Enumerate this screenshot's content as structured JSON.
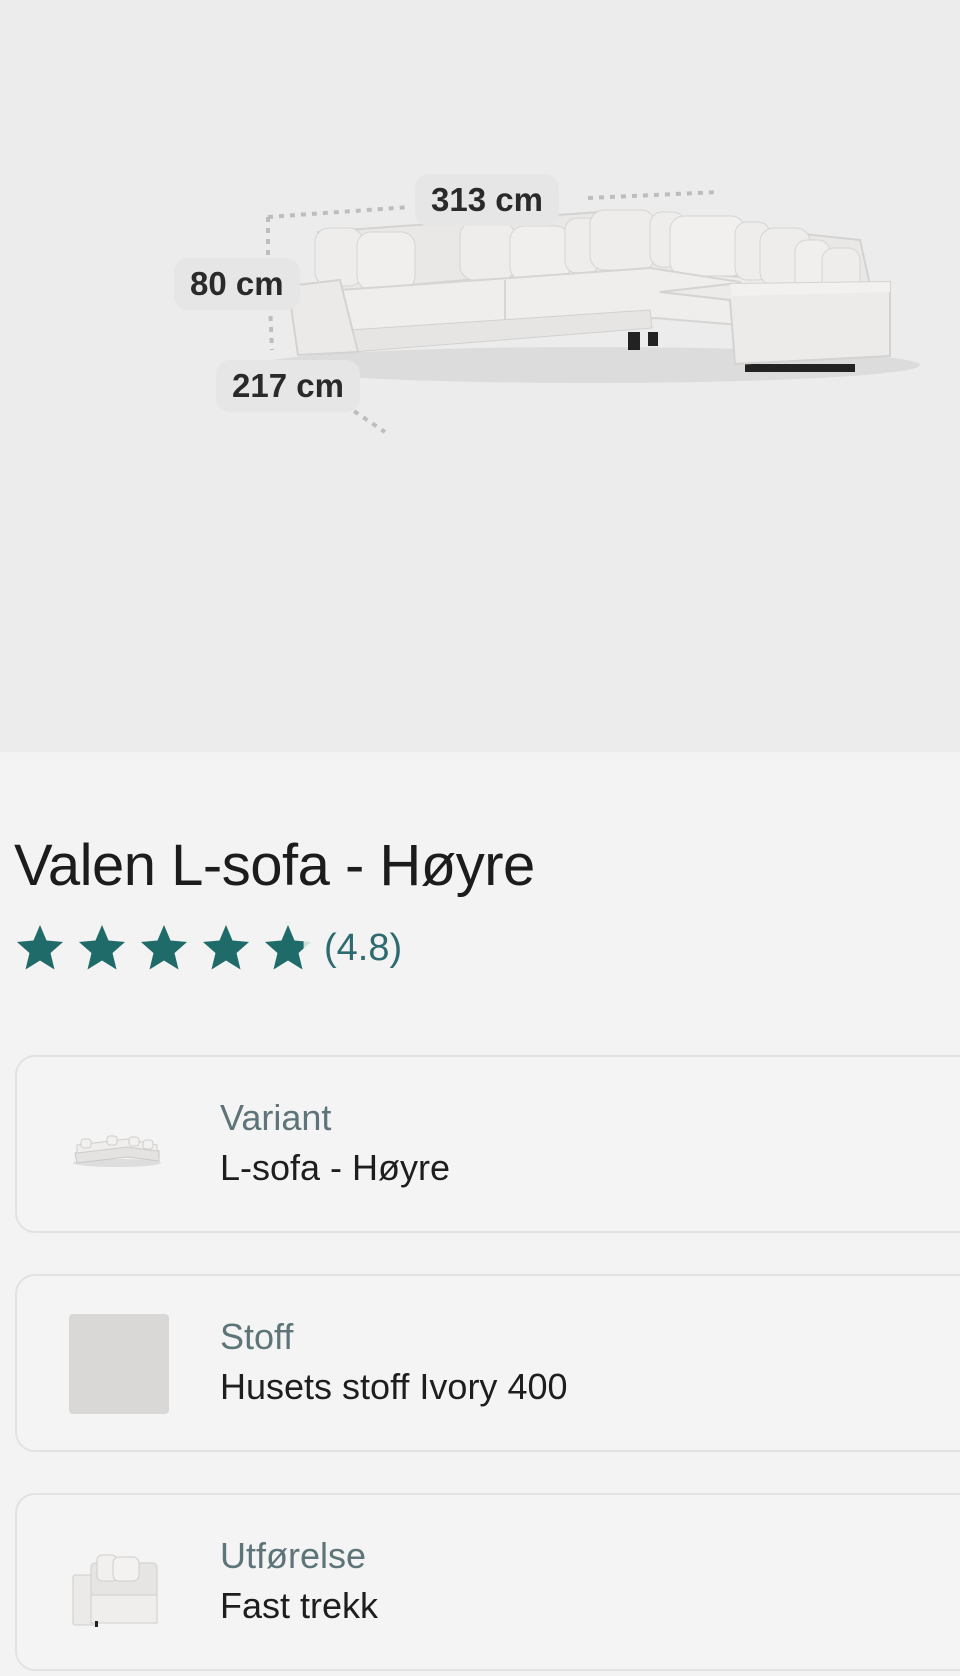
{
  "hero": {
    "dimensions": {
      "width": "313 cm",
      "height": "80 cm",
      "depth": "217 cm"
    }
  },
  "product": {
    "title": "Valen L-sofa - Høyre",
    "rating_text": "(4.8)",
    "rating_value": 4.8,
    "rating_max": 5,
    "star_color": "#1f6b6a"
  },
  "options": [
    {
      "label": "Variant",
      "value": "L-sofa - Høyre",
      "thumb": "sofa-variant-icon"
    },
    {
      "label": "Stoff",
      "value": "Husets stoff Ivory 400",
      "thumb": "fabric-swatch",
      "swatch_color": "#d9d8d6"
    },
    {
      "label": "Utførelse",
      "value": "Fast trekk",
      "thumb": "sofa-module-icon"
    }
  ]
}
